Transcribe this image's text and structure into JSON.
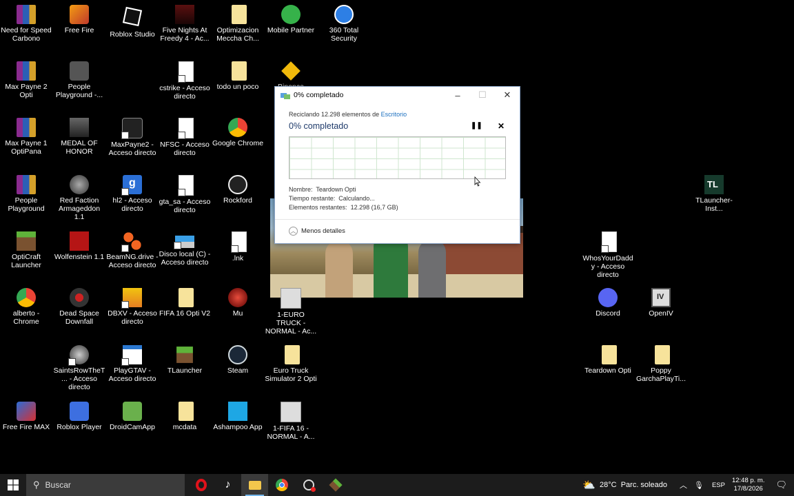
{
  "desktop": {
    "icons": [
      {
        "label": "Need for Speed Carbono",
        "icon": "winrar-icon"
      },
      {
        "label": "Free Fire",
        "icon": "free-fire-icon"
      },
      {
        "label": "Roblox Studio",
        "icon": "roblox-studio-icon"
      },
      {
        "label": "Five Nights At Freedy 4 - Ac...",
        "icon": "fnaf-icon"
      },
      {
        "label": "Optimizacion Meccha Ch...",
        "icon": "folder-icon"
      },
      {
        "label": "Mobile Partner",
        "icon": "mobile-partner-icon"
      },
      {
        "label": "360 Total Security",
        "icon": "security-icon"
      },
      {
        "label": "Max Payne 2 Opti",
        "icon": "winrar-icon"
      },
      {
        "label": "People Playground -...",
        "icon": "people-playground-icon"
      },
      {
        "label": "cstrike - Acceso directo",
        "icon": "file-icon"
      },
      {
        "label": "todo un poco",
        "icon": "folder-icon"
      },
      {
        "label": "Binance",
        "icon": "binance-icon"
      },
      {
        "label": "Max Payne 1 OptiPana",
        "icon": "winrar-icon"
      },
      {
        "label": "MEDAL OF HONOR",
        "icon": "medal-of-honor-icon"
      },
      {
        "label": "MaxPayne2 - Acceso directo",
        "icon": "maxpayne-icon"
      },
      {
        "label": "NFSC - Acceso directo",
        "icon": "file-icon"
      },
      {
        "label": "Google Chrome",
        "icon": "chrome-icon"
      },
      {
        "label": "People Playground",
        "icon": "winrar-icon"
      },
      {
        "label": "Red Faction Armageddon 1.1",
        "icon": "red-faction-icon"
      },
      {
        "label": "hl2 - Acceso directo",
        "icon": "hl2-icon"
      },
      {
        "label": "gta_sa - Acceso directo",
        "icon": "file-icon"
      },
      {
        "label": "Rockford",
        "icon": "rockford-icon"
      },
      {
        "label": "TLauncher-Inst...",
        "icon": "tlauncher-installer-icon"
      },
      {
        "label": "OptiCraft Launcher",
        "icon": "minecraft-icon"
      },
      {
        "label": "Wolfenstein 1.1",
        "icon": "wolfenstein-icon"
      },
      {
        "label": "BeamNG.drive - Acceso directo",
        "icon": "beamng-icon"
      },
      {
        "label": "Disco local (C) - Acceso directo",
        "icon": "drive-icon"
      },
      {
        "label": ".lnk",
        "icon": "file-icon"
      },
      {
        "label": "WhosYourDaddy - Acceso directo",
        "icon": "file-icon"
      },
      {
        "label": "alberto - Chrome",
        "icon": "chrome-icon"
      },
      {
        "label": "Dead Space Downfall",
        "icon": "dead-space-icon"
      },
      {
        "label": "DBXV - Acceso directo",
        "icon": "dbxv-icon"
      },
      {
        "label": "FIFA 16 Opti V2",
        "icon": "folder-icon"
      },
      {
        "label": "Mu",
        "icon": "mu-icon"
      },
      {
        "label": "1-EURO TRUCK - NORMAL - Ac...",
        "icon": "settings-file-icon"
      },
      {
        "label": "Discord",
        "icon": "discord-icon"
      },
      {
        "label": "OpenIV",
        "icon": "openiv-icon"
      },
      {
        "label": "SaintsRowTheT... - Acceso directo",
        "icon": "saints-row-icon"
      },
      {
        "label": "PlayGTAV - Acceso directo",
        "icon": "playgtav-icon"
      },
      {
        "label": "TLauncher",
        "icon": "tlauncher-icon"
      },
      {
        "label": "Steam",
        "icon": "steam-icon"
      },
      {
        "label": "Euro Truck Simulator 2 Opti",
        "icon": "folder-icon"
      },
      {
        "label": "Teardown Opti",
        "icon": "folder-icon"
      },
      {
        "label": "Poppy GarchaPlayTi...",
        "icon": "folder-icon"
      },
      {
        "label": "Free Fire MAX",
        "icon": "free-fire-max-icon"
      },
      {
        "label": "Roblox Player",
        "icon": "roblox-icon"
      },
      {
        "label": "DroidCamApp",
        "icon": "droidcam-icon"
      },
      {
        "label": "mcdata",
        "icon": "folder-icon"
      },
      {
        "label": "Ashampoo App",
        "icon": "ashampoo-icon"
      },
      {
        "label": "1-FIFA 16 - NORMAL - A...",
        "icon": "settings-file-icon"
      }
    ]
  },
  "dialog": {
    "title": "0% completado",
    "subline_prefix": "Reciclando 12.298 elementos de ",
    "subline_link": "Escritorio",
    "heading": "0% completado",
    "progress_percent": 0,
    "info": [
      {
        "label": "Nombre:",
        "value": "Teardown Opti"
      },
      {
        "label": "Tiempo restante:",
        "value": "Calculando..."
      },
      {
        "label": "Elementos restantes:",
        "value": "12.298 (16,7 GB)"
      }
    ],
    "details_label": "Menos detalles"
  },
  "taskbar": {
    "search_placeholder": "Buscar",
    "apps": [
      "opera-icon",
      "tiktok-icon",
      "file-explorer-icon",
      "chrome-icon",
      "recorder-icon",
      "minecraft-icon"
    ],
    "weather": "28°C  Parc. soleado",
    "language": "ESP",
    "time": "12:48 p. m.",
    "date": "17/8/2026"
  }
}
